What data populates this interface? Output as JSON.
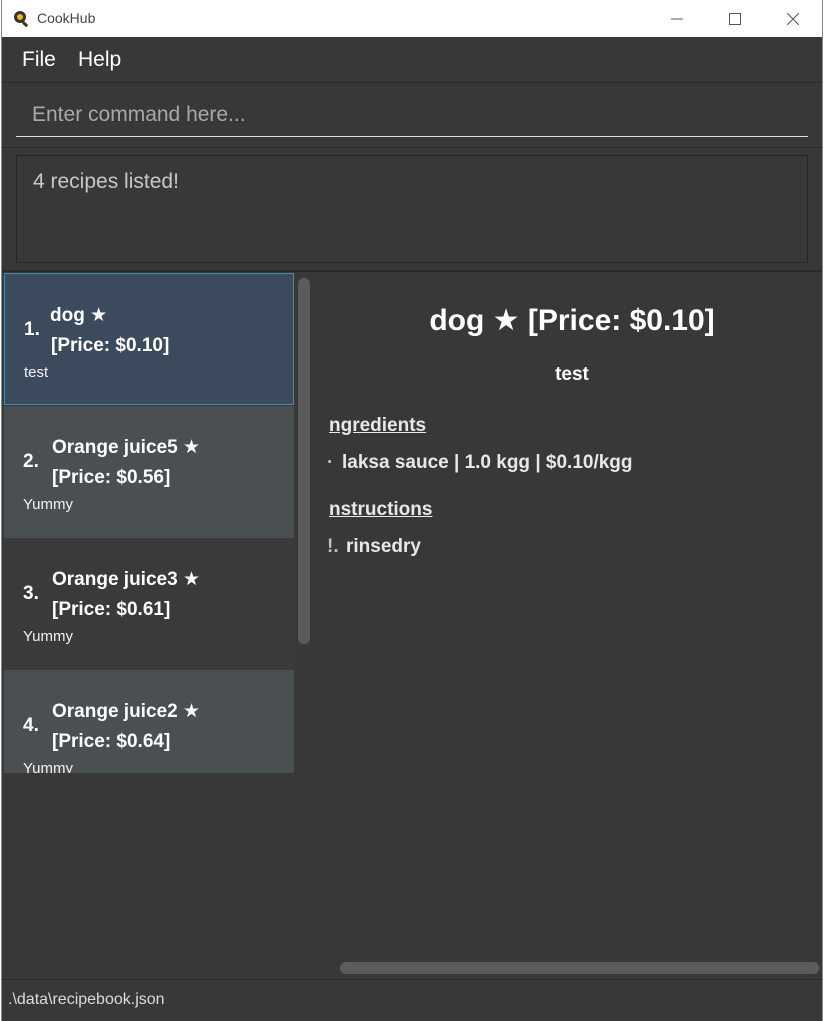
{
  "window": {
    "title": "CookHub"
  },
  "menu": {
    "file": "File",
    "help": "Help"
  },
  "command": {
    "placeholder": "Enter command here...",
    "value": ""
  },
  "result": {
    "text": "4 recipes listed!"
  },
  "recipes": [
    {
      "index": "1.",
      "name": "dog ★",
      "price": "[Price: $0.10]",
      "desc": "test"
    },
    {
      "index": "2.",
      "name": "Orange juice5 ★",
      "price": "[Price: $0.56]",
      "desc": "Yummy"
    },
    {
      "index": "3.",
      "name": "Orange juice3 ★",
      "price": "[Price: $0.61]",
      "desc": "Yummy"
    },
    {
      "index": "4.",
      "name": "Orange juice2 ★",
      "price": "[Price: $0.64]",
      "desc": "Yummy"
    }
  ],
  "detail": {
    "heading": "dog ★ [Price: $0.10]",
    "subtitle": "test",
    "ingredients_label": "ngredients",
    "ingredients": [
      {
        "bullet": "·",
        "text": "laksa sauce | 1.0 kgg | $0.10/kgg"
      }
    ],
    "instructions_label": "nstructions",
    "instructions": [
      {
        "bullet": "!.",
        "text": "rinsedry"
      }
    ]
  },
  "status": {
    "file_path": ".\\data\\recipebook.json"
  },
  "colors": {
    "background": "#383838",
    "selected_card": "#3c4a5e",
    "selected_border": "#3e8fb0",
    "alt_card": "#4a5052"
  }
}
